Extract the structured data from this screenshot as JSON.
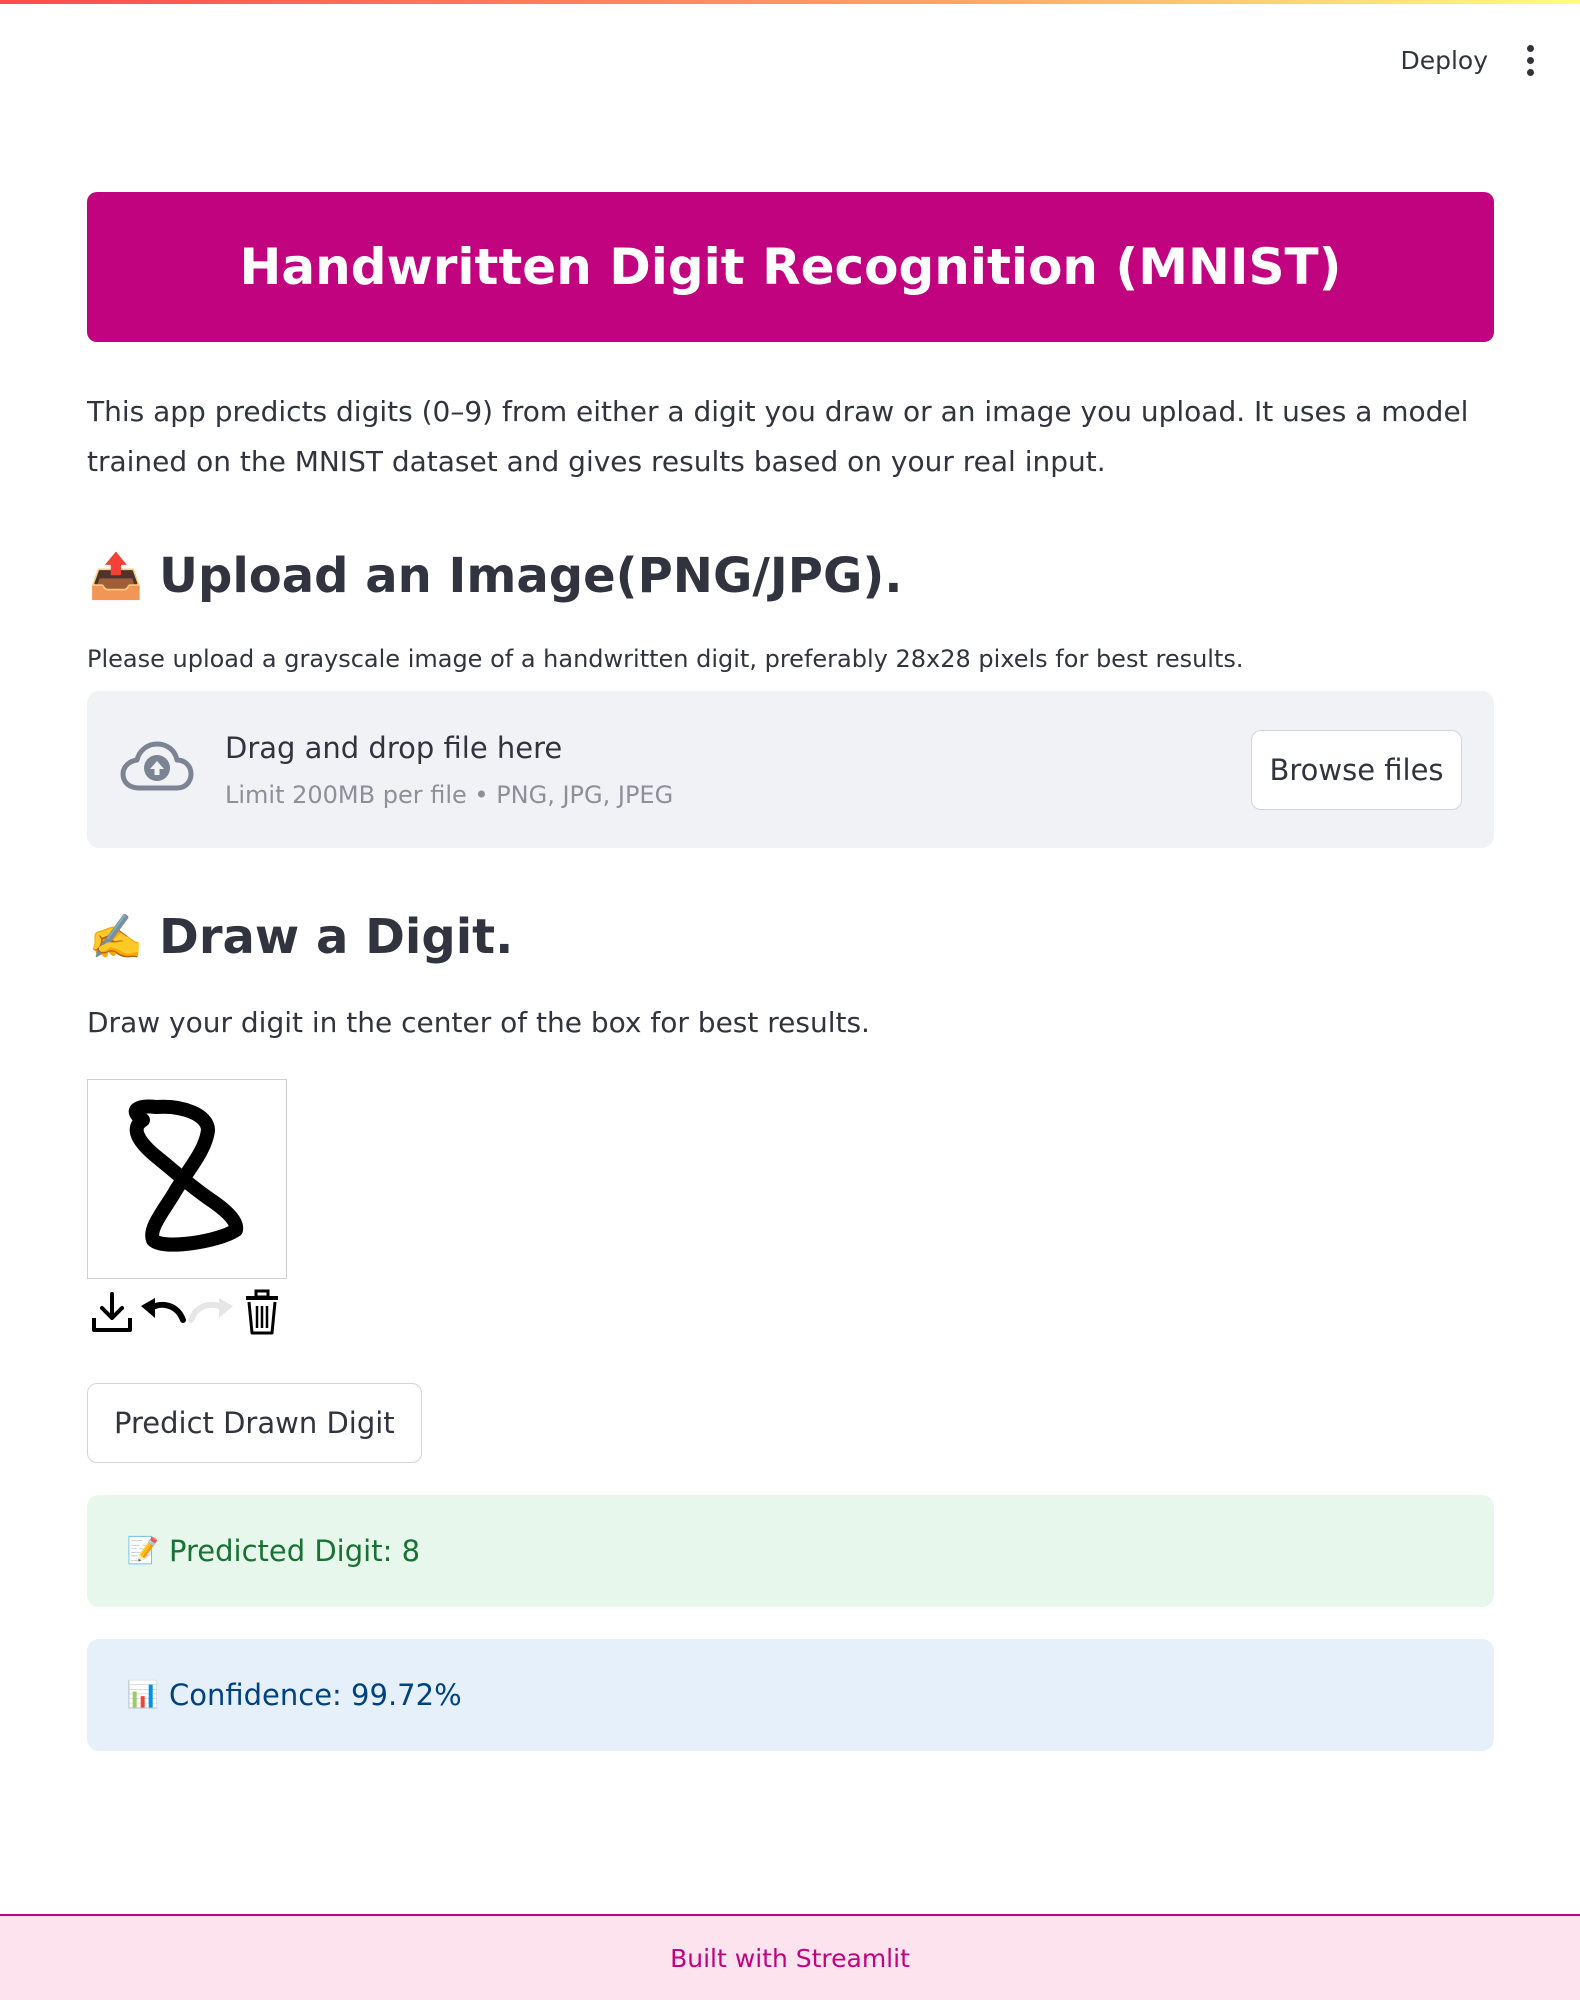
{
  "header": {
    "deploy_label": "Deploy",
    "menu_icon": "more-vert-icon"
  },
  "hero": {
    "title": "Handwritten Digit Recognition (MNIST)",
    "bg_color": "#c1037f"
  },
  "intro": {
    "text": "This app predicts digits (0–9) from either a digit you draw or an image you upload. It uses a model trained on the MNIST dataset and gives results based on your real input."
  },
  "upload_section": {
    "emoji": "📤",
    "title": "Upload an Image(PNG/JPG).",
    "help": "Please upload a grayscale image of a handwritten digit, preferably 28x28 pixels for best results.",
    "dropzone_title": "Drag and drop file here",
    "dropzone_limit": "Limit 200MB per file • PNG, JPG, JPEG",
    "browse_label": "Browse files"
  },
  "draw_section": {
    "emoji": "✍️",
    "title": "Draw a Digit.",
    "help": "Draw your digit in the center of the box for best results.",
    "canvas_tools": [
      "download-icon",
      "undo-icon",
      "redo-icon",
      "trash-icon"
    ],
    "predict_label": "Predict Drawn Digit"
  },
  "results": {
    "predicted_icon": "📝",
    "predicted_text": "Predicted Digit: 8",
    "confidence_icon": "📊",
    "confidence_text": "Confidence: 99.72%",
    "success_color": "#177233",
    "info_color": "#004280"
  },
  "footer": {
    "text": "Built with Streamlit",
    "color": "#c1037f"
  }
}
